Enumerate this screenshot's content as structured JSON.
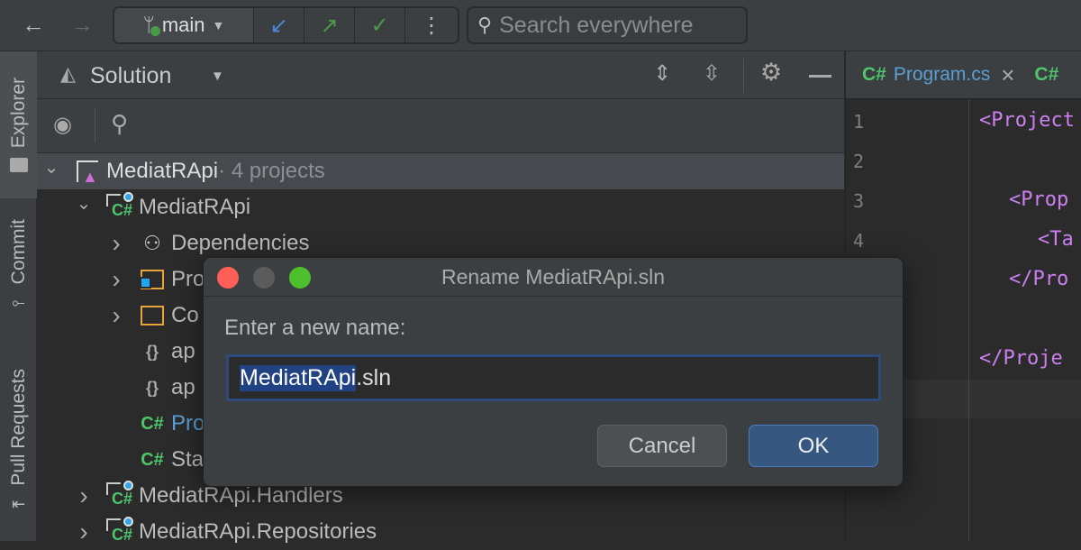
{
  "toolbar": {
    "branch": "main",
    "search_placeholder": "Search everywhere",
    "colors": {
      "update": "#4a88d8",
      "push": "#4a9b48",
      "commit": "#4a9b48",
      "branch_dot": "#4a9b48"
    }
  },
  "sidebar": {
    "tabs": [
      {
        "label": "Explorer"
      },
      {
        "label": "Commit"
      },
      {
        "label": "Pull Requests"
      }
    ]
  },
  "panel": {
    "title": "Solution"
  },
  "tree": [
    {
      "label": "MediatRApi",
      "suffix": " · 4 projects",
      "level": 0,
      "expanded": true,
      "icon": "solution-icon",
      "selected": true
    },
    {
      "label": "MediatRApi",
      "level": 1,
      "expanded": true,
      "icon": "csharp-project-icon"
    },
    {
      "label": "Dependencies",
      "level": 2,
      "expanded": false,
      "icon": "dependencies-icon"
    },
    {
      "label": "Pro",
      "level": 2,
      "expanded": false,
      "icon": "properties-folder-icon"
    },
    {
      "label": "Co",
      "level": 2,
      "expanded": false,
      "icon": "folder-icon"
    },
    {
      "label": "ap",
      "level": 2,
      "icon": "json-file-icon"
    },
    {
      "label": "ap",
      "level": 2,
      "icon": "json-file-icon"
    },
    {
      "label": "Pro",
      "level": 2,
      "icon": "csharp-file-icon",
      "highlight": true
    },
    {
      "label": "Sta",
      "level": 2,
      "icon": "csharp-file-icon"
    },
    {
      "label": "MediatRApi.Handlers",
      "level": 1,
      "expanded": false,
      "icon": "csharp-project-icon"
    },
    {
      "label": "MediatRApi.Repositories",
      "level": 1,
      "expanded": false,
      "icon": "csharp-project-icon"
    }
  ],
  "editor": {
    "tabs": [
      {
        "lang": "C#",
        "label": "Program.cs",
        "close": "×"
      },
      {
        "lang": "C#",
        "label": ""
      }
    ],
    "line_numbers": [
      "1",
      "2",
      "3",
      "4"
    ],
    "code": [
      "<Project",
      "<Prop",
      "<Ta",
      "</Pro",
      "</Proje"
    ]
  },
  "dialog": {
    "title": "Rename MediatRApi.sln",
    "prompt": "Enter a new name:",
    "value_selected": "MediatRApi",
    "value_rest": ".sln",
    "cancel": "Cancel",
    "ok": "OK"
  }
}
